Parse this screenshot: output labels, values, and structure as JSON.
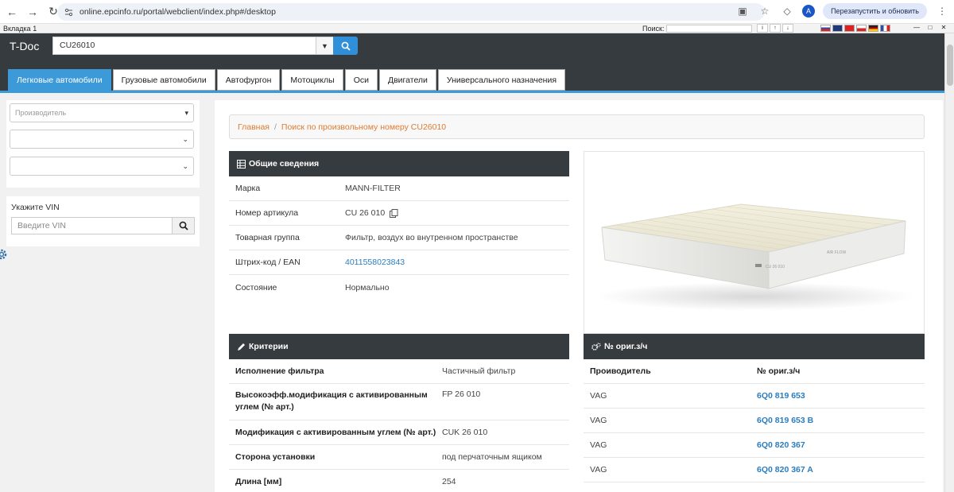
{
  "browser": {
    "url": "online.epcinfo.ru/portal/webclient/index.php#/desktop",
    "relaunch_label": "Перезапустить и обновить",
    "profile_initial": "A"
  },
  "tabstrip": {
    "tab_label": "Вкладка 1",
    "search_label": "Поиск:"
  },
  "app": {
    "brand": "T-Doc",
    "search_value": "CU26010",
    "categories": [
      {
        "label": "Легковые автомобили",
        "active": true
      },
      {
        "label": "Грузовые автомобили",
        "active": false
      },
      {
        "label": "Автофургон",
        "active": false
      },
      {
        "label": "Мотоциклы",
        "active": false
      },
      {
        "label": "Оси",
        "active": false
      },
      {
        "label": "Двигатели",
        "active": false
      },
      {
        "label": "Универсального назначения",
        "active": false
      }
    ]
  },
  "sidebar": {
    "manufacturer_placeholder": "Производитель",
    "vin_label": "Укажите VIN",
    "vin_placeholder": "Введите VIN"
  },
  "breadcrumb": {
    "home": "Главная",
    "current": "Поиск по произвольному номеру CU26010"
  },
  "general_info": {
    "title": "Общие сведения",
    "rows": [
      {
        "key": "Марка",
        "value": "MANN-FILTER"
      },
      {
        "key": "Номер артикула",
        "value": "CU 26 010"
      },
      {
        "key": "Товарная группа",
        "value": "Фильтр, воздух во внутренном пространстве"
      },
      {
        "key": "Штрих-код / EAN",
        "value": "4011558023843"
      },
      {
        "key": "Состояние",
        "value": "Нормально"
      }
    ]
  },
  "criteria": {
    "title": "Критерии",
    "rows": [
      {
        "key": "Исполнение фильтра",
        "value": "Частичный фильтр"
      },
      {
        "key": "Высокоэфф.модификация с активированным углем (№ арт.)",
        "value": "FP 26 010"
      },
      {
        "key": "Модификация с активированным углем (№ арт.)",
        "value": "CUK 26 010"
      },
      {
        "key": "Сторона установки",
        "value": "под перчаточным ящиком"
      },
      {
        "key": "Длина [мм]",
        "value": "254"
      }
    ]
  },
  "oe_numbers": {
    "title": "№ ориг.з/ч",
    "col_manufacturer": "Проиводитель",
    "col_number": "№ ориг.з/ч",
    "rows": [
      {
        "manufacturer": "VAG",
        "number": "6Q0 819 653"
      },
      {
        "manufacturer": "VAG",
        "number": "6Q0 819 653 B"
      },
      {
        "manufacturer": "VAG",
        "number": "6Q0 820 367"
      },
      {
        "manufacturer": "VAG",
        "number": "6Q0 820 367 A"
      }
    ]
  },
  "colors": {
    "header_bg": "#363b40",
    "accent": "#3d9ad8",
    "link": "#2a7dc0",
    "breadcrumb": "#e07b2e"
  }
}
